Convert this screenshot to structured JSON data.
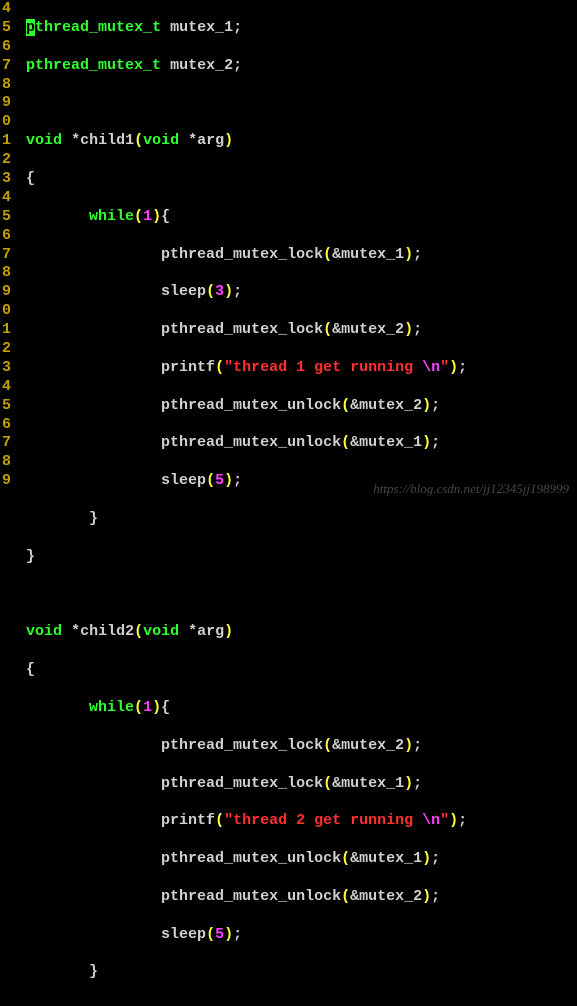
{
  "gutter": [
    "4",
    "5",
    "6",
    "7",
    "8",
    "9",
    "0",
    "1",
    "2",
    "3",
    "4",
    "5",
    "6",
    "7",
    "8",
    "9",
    "0",
    "1",
    "2",
    "3",
    "4",
    "5",
    "6",
    "7",
    "8",
    "9"
  ],
  "l4": {
    "p": "p",
    "decl_type": "thread_mutex_t",
    "var": "mutex_1",
    "semi": ";"
  },
  "l5": {
    "decl_type": "pthread_mutex_t",
    "var": "mutex_2",
    "semi": ";"
  },
  "l7": {
    "void": "void",
    "star": "*",
    "fn": "child1",
    "lp": "(",
    "argtype": "void",
    "argstar": "*",
    "arg": "arg",
    "rp": ")"
  },
  "l8": {
    "brace": "{"
  },
  "l9": {
    "indent": "        ",
    "while": "while",
    "lp": "(",
    "num": "1",
    "rp": ")",
    "brace": "{"
  },
  "l10": {
    "indent": "                ",
    "call": "pthread_mutex_lock",
    "lp": "(",
    "amp": "&",
    "arg": "mutex_1",
    "rp": ")",
    "semi": ";"
  },
  "l11": {
    "indent": "                ",
    "call": "sleep",
    "lp": "(",
    "num": "3",
    "rp": ")",
    "semi": ";"
  },
  "l12": {
    "indent": "                ",
    "call": "pthread_mutex_lock",
    "lp": "(",
    "amp": "&",
    "arg": "mutex_2",
    "rp": ")",
    "semi": ";"
  },
  "l13": {
    "indent": "                ",
    "call": "printf",
    "lp": "(",
    "q1": "\"",
    "str": "thread 1 get running ",
    "esc": "\\n",
    "q2": "\"",
    "rp": ")",
    "semi": ";"
  },
  "l14": {
    "indent": "                ",
    "call": "pthread_mutex_unlock",
    "lp": "(",
    "amp": "&",
    "arg": "mutex_2",
    "rp": ")",
    "semi": ";"
  },
  "l15": {
    "indent": "                ",
    "call": "pthread_mutex_unlock",
    "lp": "(",
    "amp": "&",
    "arg": "mutex_1",
    "rp": ")",
    "semi": ";"
  },
  "l16": {
    "indent": "                ",
    "call": "sleep",
    "lp": "(",
    "num": "5",
    "rp": ")",
    "semi": ";"
  },
  "l17": {
    "indent": "        ",
    "brace": "}"
  },
  "l18": {
    "brace": "}"
  },
  "l20": {
    "void": "void",
    "star": "*",
    "fn": "child2",
    "lp": "(",
    "argtype": "void",
    "argstar": "*",
    "arg": "arg",
    "rp": ")"
  },
  "l21": {
    "brace": "{"
  },
  "l22": {
    "indent": "        ",
    "while": "while",
    "lp": "(",
    "num": "1",
    "rp": ")",
    "brace": "{"
  },
  "l23": {
    "indent": "                ",
    "call": "pthread_mutex_lock",
    "lp": "(",
    "amp": "&",
    "arg": "mutex_2",
    "rp": ")",
    "semi": ";"
  },
  "l24": {
    "indent": "                ",
    "call": "pthread_mutex_lock",
    "lp": "(",
    "amp": "&",
    "arg": "mutex_1",
    "rp": ")",
    "semi": ";"
  },
  "l25": {
    "indent": "                ",
    "call": "printf",
    "lp": "(",
    "q1": "\"",
    "str": "thread 2 get running ",
    "esc": "\\n",
    "q2": "\"",
    "rp": ")",
    "semi": ";"
  },
  "l26": {
    "indent": "                ",
    "call": "pthread_mutex_unlock",
    "lp": "(",
    "amp": "&",
    "arg": "mutex_1",
    "rp": ")",
    "semi": ";"
  },
  "l27": {
    "indent": "                ",
    "call": "pthread_mutex_unlock",
    "lp": "(",
    "amp": "&",
    "arg": "mutex_2",
    "rp": ")",
    "semi": ";"
  },
  "l28": {
    "indent": "                ",
    "call": "sleep",
    "lp": "(",
    "num": "5",
    "rp": ")",
    "semi": ";"
  },
  "l29": {
    "indent": "        ",
    "brace": "}"
  },
  "watermark": "https://blog.csdn.net/jj12345jj198999"
}
